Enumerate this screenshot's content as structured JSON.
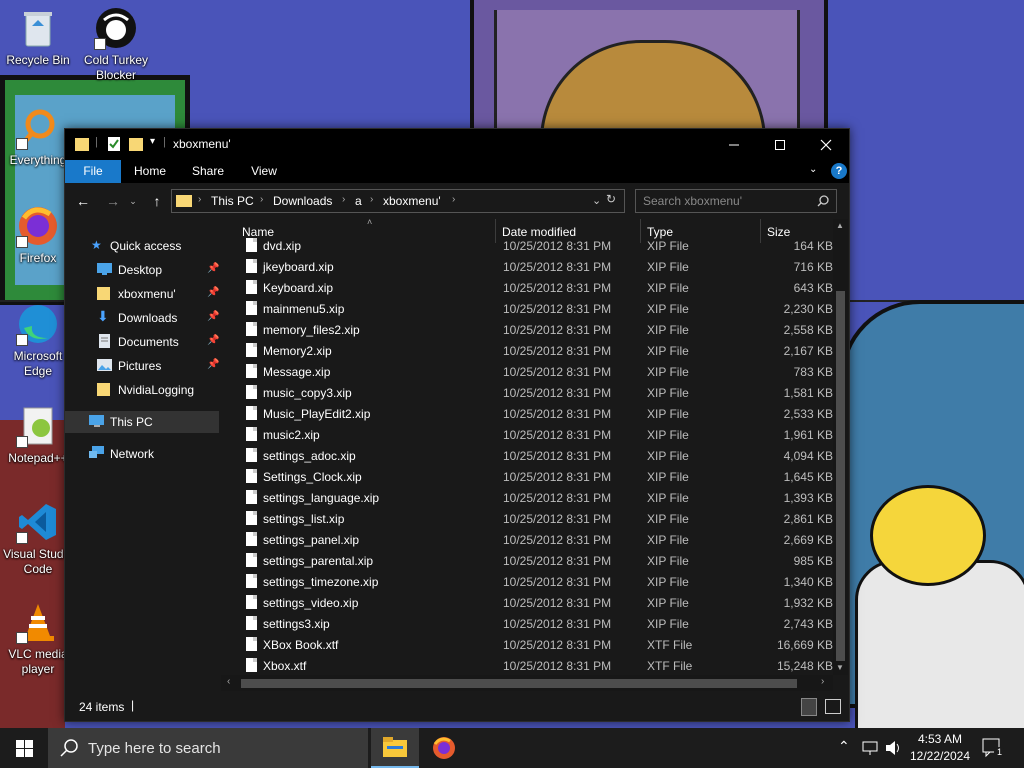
{
  "desktop": {
    "icons": [
      {
        "label": "Recycle Bin"
      },
      {
        "label": "Cold Turkey Blocker"
      },
      {
        "label": "Everything"
      },
      {
        "label": "Firefox"
      },
      {
        "label": "Microsoft Edge"
      },
      {
        "label": "Notepad++"
      },
      {
        "label": "Visual Studio Code"
      },
      {
        "label": "VLC media player"
      }
    ]
  },
  "window": {
    "title": "xboxmenu'",
    "ribbon": {
      "file": "File",
      "home": "Home",
      "share": "Share",
      "view": "View"
    },
    "address": {
      "part1": "This PC",
      "part2": "Downloads",
      "part3": "a",
      "part4": "xboxmenu'"
    },
    "search_placeholder": "Search xboxmenu'",
    "nav": [
      {
        "label": "Quick access"
      },
      {
        "label": "Desktop"
      },
      {
        "label": "xboxmenu'"
      },
      {
        "label": "Downloads"
      },
      {
        "label": "Documents"
      },
      {
        "label": "Pictures"
      },
      {
        "label": "NvidiaLogging"
      },
      {
        "label": "This PC"
      },
      {
        "label": "Network"
      }
    ],
    "columns": {
      "name": "Name",
      "date": "Date modified",
      "type": "Type",
      "size": "Size"
    },
    "files": [
      {
        "name": "dvd.xip",
        "date": "10/25/2012 8:31 PM",
        "type": "XIP File",
        "size": "164 KB"
      },
      {
        "name": "jkeyboard.xip",
        "date": "10/25/2012 8:31 PM",
        "type": "XIP File",
        "size": "716 KB"
      },
      {
        "name": "Keyboard.xip",
        "date": "10/25/2012 8:31 PM",
        "type": "XIP File",
        "size": "643 KB"
      },
      {
        "name": "mainmenu5.xip",
        "date": "10/25/2012 8:31 PM",
        "type": "XIP File",
        "size": "2,230 KB"
      },
      {
        "name": "memory_files2.xip",
        "date": "10/25/2012 8:31 PM",
        "type": "XIP File",
        "size": "2,558 KB"
      },
      {
        "name": "Memory2.xip",
        "date": "10/25/2012 8:31 PM",
        "type": "XIP File",
        "size": "2,167 KB"
      },
      {
        "name": "Message.xip",
        "date": "10/25/2012 8:31 PM",
        "type": "XIP File",
        "size": "783 KB"
      },
      {
        "name": "music_copy3.xip",
        "date": "10/25/2012 8:31 PM",
        "type": "XIP File",
        "size": "1,581 KB"
      },
      {
        "name": "Music_PlayEdit2.xip",
        "date": "10/25/2012 8:31 PM",
        "type": "XIP File",
        "size": "2,533 KB"
      },
      {
        "name": "music2.xip",
        "date": "10/25/2012 8:31 PM",
        "type": "XIP File",
        "size": "1,961 KB"
      },
      {
        "name": "settings_adoc.xip",
        "date": "10/25/2012 8:31 PM",
        "type": "XIP File",
        "size": "4,094 KB"
      },
      {
        "name": "Settings_Clock.xip",
        "date": "10/25/2012 8:31 PM",
        "type": "XIP File",
        "size": "1,645 KB"
      },
      {
        "name": "settings_language.xip",
        "date": "10/25/2012 8:31 PM",
        "type": "XIP File",
        "size": "1,393 KB"
      },
      {
        "name": "settings_list.xip",
        "date": "10/25/2012 8:31 PM",
        "type": "XIP File",
        "size": "2,861 KB"
      },
      {
        "name": "settings_panel.xip",
        "date": "10/25/2012 8:31 PM",
        "type": "XIP File",
        "size": "2,669 KB"
      },
      {
        "name": "settings_parental.xip",
        "date": "10/25/2012 8:31 PM",
        "type": "XIP File",
        "size": "985 KB"
      },
      {
        "name": "settings_timezone.xip",
        "date": "10/25/2012 8:31 PM",
        "type": "XIP File",
        "size": "1,340 KB"
      },
      {
        "name": "settings_video.xip",
        "date": "10/25/2012 8:31 PM",
        "type": "XIP File",
        "size": "1,932 KB"
      },
      {
        "name": "settings3.xip",
        "date": "10/25/2012 8:31 PM",
        "type": "XIP File",
        "size": "2,743 KB"
      },
      {
        "name": "XBox Book.xtf",
        "date": "10/25/2012 8:31 PM",
        "type": "XTF File",
        "size": "16,669 KB"
      },
      {
        "name": "Xbox.xtf",
        "date": "10/25/2012 8:31 PM",
        "type": "XTF File",
        "size": "15,248 KB"
      }
    ],
    "status": {
      "count": "24 items"
    }
  },
  "taskbar": {
    "search_placeholder": "Type here to search",
    "time": "4:53 AM",
    "date": "12/22/2024",
    "notification_count": "1"
  },
  "colors": {
    "accent": "#1979ca",
    "window_bg": "#191919",
    "taskbar": "#1c1c1c"
  }
}
